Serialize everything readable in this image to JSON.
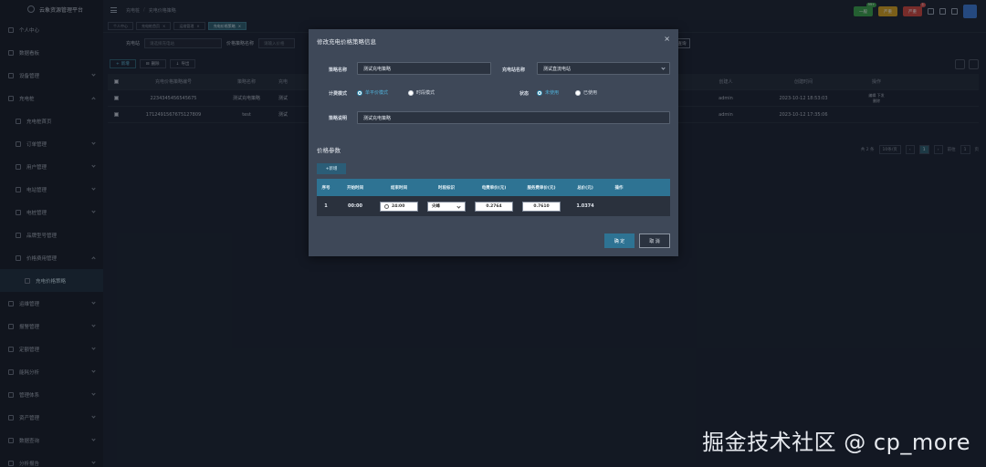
{
  "app": {
    "title": "云象资源管理平台"
  },
  "sidebar": {
    "items": [
      {
        "label": "个人中心",
        "type": "top"
      },
      {
        "label": "数据看板",
        "type": "top"
      },
      {
        "label": "设备管理",
        "type": "top",
        "chev": "down"
      },
      {
        "label": "充电桩",
        "type": "top",
        "chev": "up"
      },
      {
        "label": "充电桩首页",
        "type": "sub"
      },
      {
        "label": "订单管理",
        "type": "sub",
        "chev": "down"
      },
      {
        "label": "用户管理",
        "type": "sub",
        "chev": "down"
      },
      {
        "label": "电站管理",
        "type": "sub",
        "chev": "down"
      },
      {
        "label": "电桩管理",
        "type": "sub",
        "chev": "down"
      },
      {
        "label": "品牌型号管理",
        "type": "sub"
      },
      {
        "label": "价格费用管理",
        "type": "sub",
        "chev": "up"
      },
      {
        "label": "充电价格策略",
        "type": "sub2"
      },
      {
        "label": "运维管理",
        "type": "top",
        "chev": "down"
      },
      {
        "label": "报警管理",
        "type": "top",
        "chev": "down"
      },
      {
        "label": "定额管理",
        "type": "top",
        "chev": "down"
      },
      {
        "label": "能耗分析",
        "type": "top",
        "chev": "down"
      },
      {
        "label": "管理体系",
        "type": "top",
        "chev": "down"
      },
      {
        "label": "资产管理",
        "type": "top",
        "chev": "down"
      },
      {
        "label": "数据查询",
        "type": "top",
        "chev": "down"
      },
      {
        "label": "分析报告",
        "type": "top",
        "chev": "down"
      }
    ]
  },
  "topbar": {
    "breadcrumb": [
      "充电桩",
      "充电价格策略"
    ],
    "badges": [
      {
        "label": "一般",
        "count": "99+",
        "color": "#3aa24a"
      },
      {
        "label": "严重",
        "count": "",
        "color": "#d7a21e"
      },
      {
        "label": "严重",
        "count": "1",
        "color": "#d0453c"
      }
    ]
  },
  "tabs": [
    "个人中心",
    "充电桩首页",
    "运维管理",
    "充电价格策略"
  ],
  "filters": {
    "station_label": "充电站",
    "station_placeholder": "请选择充电站",
    "name_label": "价格策略名称",
    "name_placeholder": "请输入价格",
    "search": "查询"
  },
  "actions": {
    "add": "新增",
    "delete": "删除",
    "export": "导出"
  },
  "table": {
    "headers": [
      "充电价格策略编号",
      "策略名称",
      "充电",
      "",
      "",
      "",
      "",
      "",
      "创建人",
      "创建时间",
      "操作"
    ],
    "rows": [
      {
        "id": "2234345456545675",
        "name": "测试充电策略",
        "station": "测试",
        "creator": "admin",
        "time": "2023-10-12 18:53:03",
        "ops": "编辑  下发",
        "op2": "删除"
      },
      {
        "id": "1712491567675127809",
        "name": "test",
        "station": "测试",
        "creator": "admin",
        "time": "2023-10-12 17:35:06",
        "ops": "",
        "op2": ""
      }
    ]
  },
  "pagination": {
    "total": "共 2 条",
    "size": "10条/页",
    "page": "1",
    "goto": "前往",
    "goto_val": "1",
    "unit": "页"
  },
  "modal": {
    "title": "修改充电价格策略信息",
    "close": "×",
    "fields": {
      "name_label": "策略名称",
      "name_value": "测试充电策略",
      "station_label": "充电站名称",
      "station_value": "测试直流电站",
      "mode_label": "计费模式",
      "mode_opt1": "单平价模式",
      "mode_opt2": "时段模式",
      "status_label": "状态",
      "status_opt1": "未使用",
      "status_opt2": "已使用",
      "desc_label": "策略说明",
      "desc_value": "测试充电策略"
    },
    "price_section": "价格参数",
    "add": "新增",
    "price_table": {
      "headers": [
        "序号",
        "开始时间",
        "结束时间",
        "时段标识",
        "电费单价(元)",
        "服务费单价(元)",
        "总价(元)",
        "操作"
      ],
      "rows": [
        {
          "seq": "1",
          "start": "00:00",
          "end": "24:00",
          "tag": "尖峰",
          "elec": "0.2764",
          "service": "0.7610",
          "total": "1.0374",
          "op": ""
        }
      ]
    },
    "ok": "确 定",
    "cancel": "取 消"
  },
  "watermark": "掘金技术社区 @ cp_more"
}
